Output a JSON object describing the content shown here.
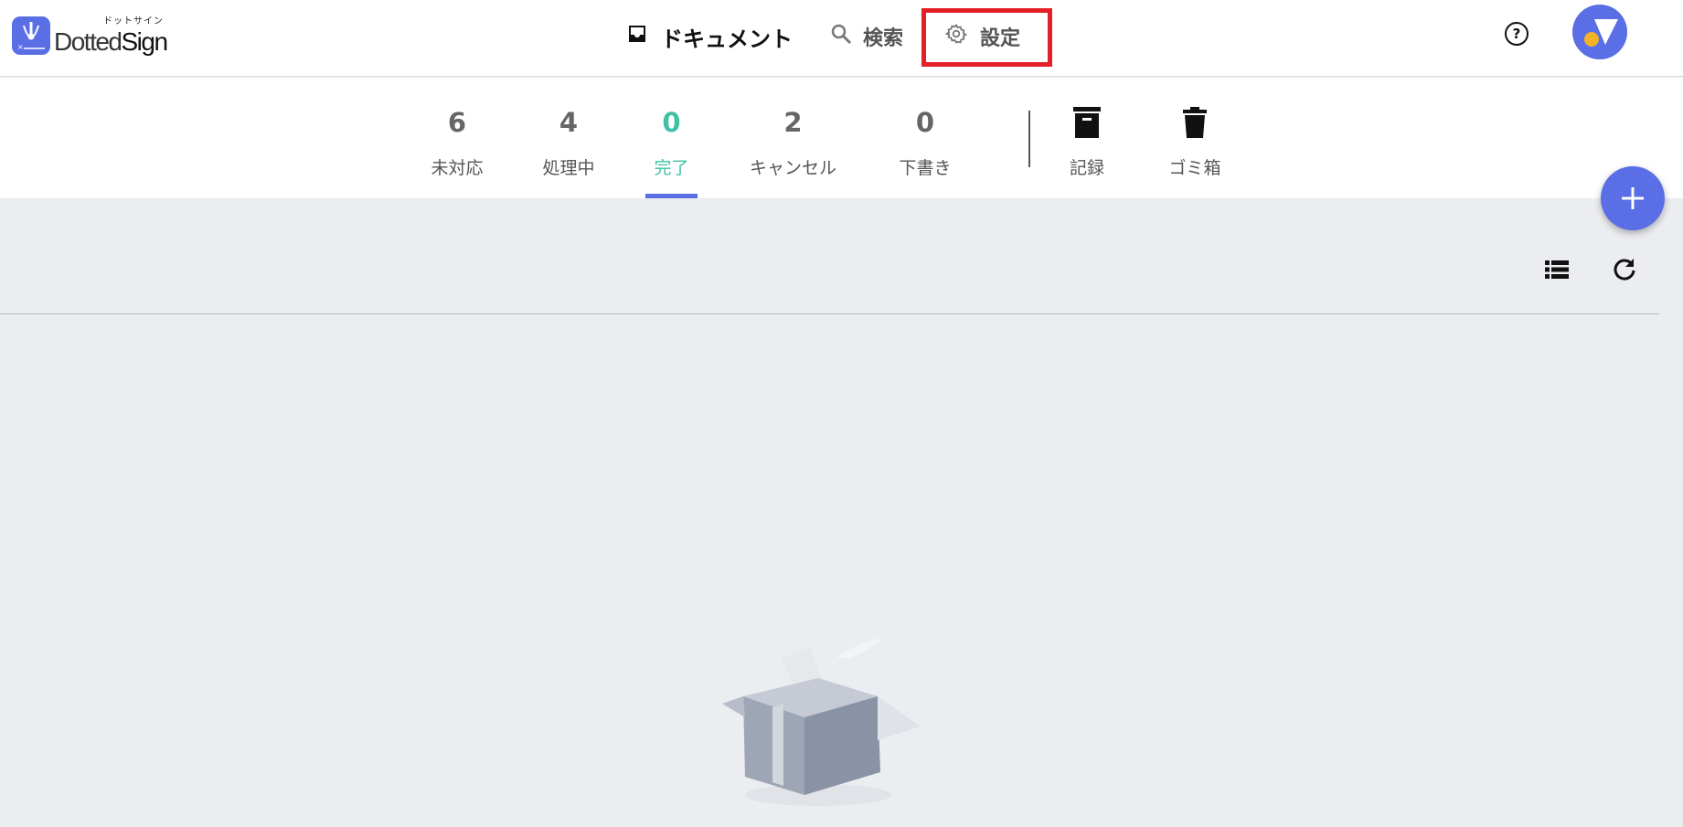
{
  "app": {
    "logo_subtitle": "ドットサイン",
    "logo_name_part1": "Dotted",
    "logo_name_part2": "Sign"
  },
  "nav": {
    "documents_label": "ドキュメント",
    "search_label": "検索",
    "settings_label": "設定"
  },
  "header": {
    "help_symbol": "?"
  },
  "tabs": [
    {
      "count": "6",
      "label": "未対応",
      "active": false
    },
    {
      "count": "4",
      "label": "処理中",
      "active": false
    },
    {
      "count": "0",
      "label": "完了",
      "active": true
    },
    {
      "count": "2",
      "label": "キャンセル",
      "active": false
    },
    {
      "count": "0",
      "label": "下書き",
      "active": false
    }
  ],
  "tab_actions": [
    {
      "label": "記録",
      "icon": "archive-icon"
    },
    {
      "label": "ゴミ箱",
      "icon": "trash-icon"
    }
  ],
  "colors": {
    "brand": "#5a6ee6",
    "active_tab": "#3fc1a5",
    "highlight": "#e31f27",
    "background": "#ecedf1"
  },
  "toolbar": {
    "list_icon": "list-view-icon",
    "refresh_icon": "refresh-icon"
  }
}
